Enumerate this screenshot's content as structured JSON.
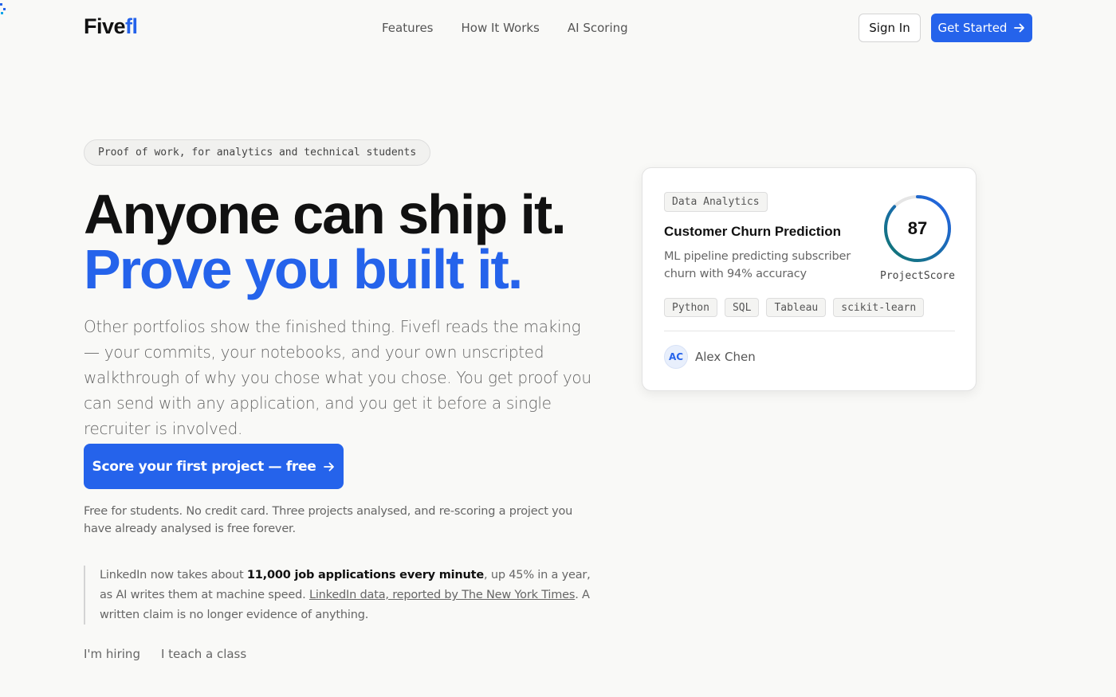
{
  "nav": {
    "logo_main": "Five",
    "logo_accent": "fl",
    "links": [
      "Features",
      "How It Works",
      "AI Scoring"
    ],
    "sign_in": "Sign In",
    "get_started": "Get Started"
  },
  "hero": {
    "pill": "Proof of work, for analytics and technical students",
    "headline_1": "Anyone can ship it.",
    "headline_2": "Prove you built it.",
    "lead": "Other portfolios show the finished thing. Fivefl reads the making — your commits, your notebooks, and your own unscripted walkthrough of why you chose what you chose. You get proof you can send with any application, and you get it before a single recruiter is involved.",
    "cta": "Score your first project — free",
    "fineprint": "Free for students. No credit card. Three projects analysed, and re-scoring a project you have already analysed is free forever.",
    "quote": {
      "pre": "LinkedIn now takes about ",
      "bold": "11,000 job applications every minute",
      "mid": ", up 45% in a year, as AI writes them at machine speed. ",
      "link": "LinkedIn data, reported by The New York Times",
      "post": ". A written claim is no longer evidence of anything."
    },
    "bottom_links": [
      "I'm hiring",
      "I teach a class"
    ]
  },
  "card": {
    "category": "Data Analytics",
    "title": "Customer Churn Prediction",
    "description": "ML pipeline predicting subscriber churn with 94% accuracy",
    "score": "87",
    "score_fraction": 0.87,
    "score_label": "ProjectScore",
    "skills": [
      "Python",
      "SQL",
      "Tableau",
      "scikit-learn"
    ],
    "avatar_initials": "AC",
    "author": "Alex Chen"
  },
  "colors": {
    "accent": "#2563eb",
    "ring_start": "#0f766e",
    "ring_end": "#2563eb",
    "ring_track": "#e5e5e5"
  },
  "icons": {
    "arrow": "arrow-right-icon"
  }
}
